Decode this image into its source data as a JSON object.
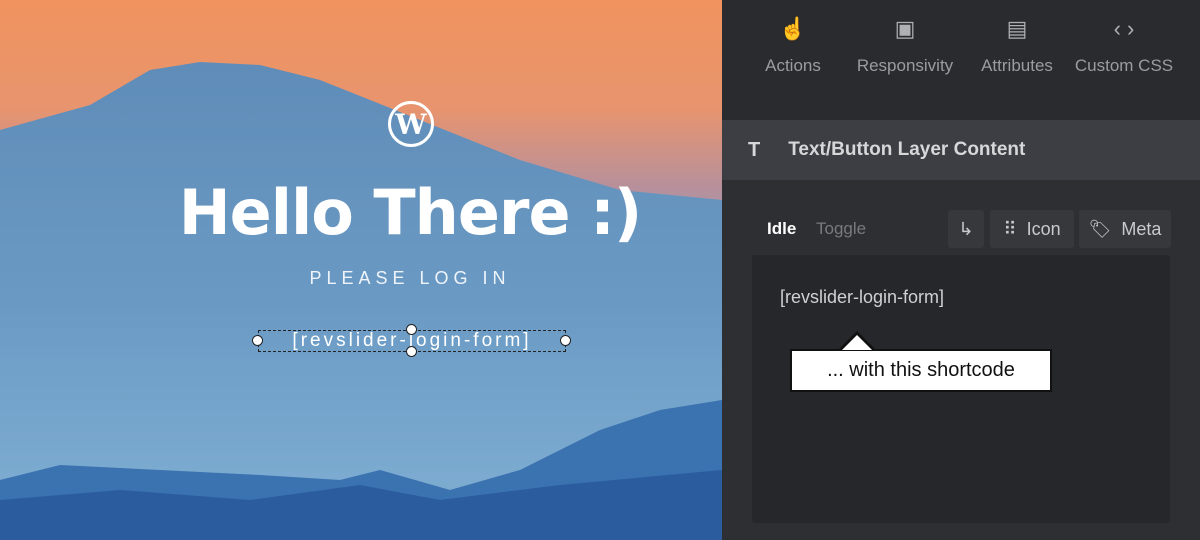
{
  "slide": {
    "logo": "W",
    "title": "Hello There :)",
    "subtitle": "PLEASE LOG IN",
    "shortcode_layer": "[revslider-login-form]"
  },
  "panel": {
    "toolbar": [
      {
        "label": "Actions",
        "icon": "hand-pointer-icon"
      },
      {
        "label": "Responsivity",
        "icon": "responsive-image-icon"
      },
      {
        "label": "Attributes",
        "icon": "document-icon"
      },
      {
        "label": "Custom CSS",
        "icon": "code-icon"
      }
    ],
    "section_title": "Text/Button Layer Content",
    "section_icon": "T",
    "tabs": {
      "idle": "Idle",
      "toggle": "Toggle"
    },
    "buttons": {
      "icon": "Icon",
      "meta": "Meta"
    },
    "editor_value": "[revslider-login-form]"
  },
  "tooltip": "... with this shortcode"
}
